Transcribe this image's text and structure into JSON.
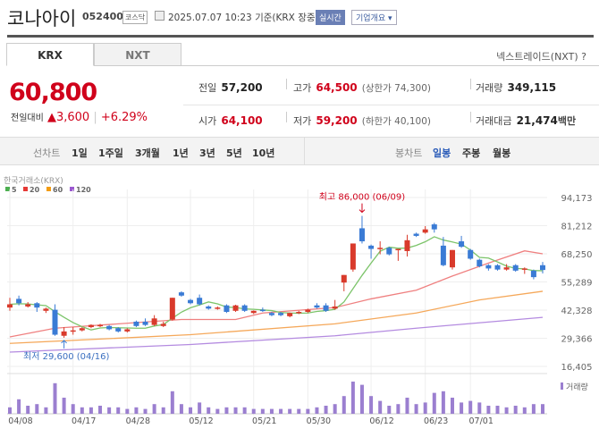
{
  "header": {
    "name": "코나아이",
    "code": "052400",
    "market": "코스닥",
    "datetime": "2025.07.07 10:23",
    "basis": "기준(KRX 장중)",
    "realtime_label": "실시간",
    "company_btn": "기업개요 ▾"
  },
  "tabs": [
    {
      "label": "KRX",
      "active": true
    },
    {
      "label": "NXT",
      "active": false
    }
  ],
  "nxt_link": "넥스트레이드(NXT) ?",
  "quote": {
    "price": "60,800",
    "change_label": "전일대비",
    "change": "▲3,600",
    "change_pct": "+6.29%",
    "prev_label": "전일",
    "prev": "57,200",
    "high_label": "고가",
    "high": "64,500",
    "upper_limit": "(상한가 74,300)",
    "volume_label": "거래량",
    "volume": "349,115",
    "open_label": "시가",
    "open": "64,100",
    "low_label": "저가",
    "low": "59,200",
    "lower_limit": "(하한가 40,100)",
    "amount_label": "거래대금",
    "amount": "21,474",
    "amount_unit": "백만"
  },
  "period_bar": {
    "line_label": "선차트",
    "line_periods": [
      "1일",
      "1주일",
      "3개월",
      "1년",
      "3년",
      "5년",
      "10년"
    ],
    "candle_label": "봉차트",
    "candle_periods": [
      "일봉",
      "주봉",
      "월봉"
    ],
    "selected": "일봉"
  },
  "chart_data": {
    "type": "candlestick",
    "source_label": "한국거래소(KRX)",
    "legend": [
      {
        "label": "5",
        "color": "#4caf50"
      },
      {
        "label": "20",
        "color": "#e53935"
      },
      {
        "label": "60",
        "color": "#f39c12"
      },
      {
        "label": "120",
        "color": "#9b59d0"
      }
    ],
    "y_ticks": [
      "94,173",
      "81,212",
      "68,250",
      "55,289",
      "42,328",
      "29,366",
      "16,405"
    ],
    "ylim": [
      16405,
      94173
    ],
    "x_ticks": [
      {
        "label": "04/08",
        "i": 0
      },
      {
        "label": "04/17",
        "i": 7
      },
      {
        "label": "04/28",
        "i": 13
      },
      {
        "label": "05/12",
        "i": 20
      },
      {
        "label": "05/21",
        "i": 27
      },
      {
        "label": "05/30",
        "i": 33
      },
      {
        "label": "06/12",
        "i": 40
      },
      {
        "label": "06/23",
        "i": 46
      },
      {
        "label": "07/01",
        "i": 51
      }
    ],
    "max_annotation": "최고 86,000 (06/09)",
    "max_index": 39,
    "min_annotation": "최저 29,600 (04/16)",
    "min_index": 6,
    "volume_label": "거래량",
    "ohlc": [
      [
        43500,
        48000,
        42000,
        45000
      ],
      [
        47500,
        49000,
        44500,
        45500
      ],
      [
        44000,
        46000,
        43500,
        45000
      ],
      [
        45500,
        46000,
        41500,
        43500
      ],
      [
        42000,
        43500,
        41000,
        43000
      ],
      [
        42500,
        45000,
        30500,
        31000
      ],
      [
        30500,
        34500,
        29600,
        32500
      ],
      [
        32500,
        34500,
        31000,
        33000
      ],
      [
        33000,
        34500,
        32500,
        34000
      ],
      [
        34500,
        35800,
        34000,
        35500
      ],
      [
        35000,
        36000,
        34500,
        35500
      ],
      [
        35000,
        35500,
        33000,
        33500
      ],
      [
        34000,
        34500,
        32000,
        32500
      ],
      [
        32500,
        34000,
        32000,
        33500
      ],
      [
        37000,
        37500,
        34500,
        35000
      ],
      [
        37000,
        38500,
        35000,
        35500
      ],
      [
        35500,
        40000,
        35000,
        38500
      ],
      [
        35000,
        37000,
        34500,
        36000
      ],
      [
        38000,
        48000,
        37500,
        48000
      ],
      [
        50500,
        51000,
        48500,
        49000
      ],
      [
        47000,
        47500,
        45000,
        45500
      ],
      [
        48000,
        49500,
        44500,
        45000
      ],
      [
        44000,
        44500,
        42500,
        43000
      ],
      [
        43000,
        44000,
        42500,
        43500
      ],
      [
        44500,
        45000,
        41000,
        41500
      ],
      [
        42000,
        44800,
        41500,
        44500
      ],
      [
        44500,
        45000,
        41500,
        42000
      ],
      [
        41000,
        42200,
        40500,
        42000
      ],
      [
        42500,
        43500,
        41500,
        42000
      ],
      [
        41000,
        41500,
        39500,
        40000
      ],
      [
        41000,
        41500,
        39500,
        40000
      ],
      [
        39500,
        41200,
        39000,
        41000
      ],
      [
        41000,
        42000,
        40500,
        41500
      ],
      [
        41500,
        43000,
        41000,
        42500
      ],
      [
        44500,
        45500,
        43000,
        43500
      ],
      [
        44500,
        45500,
        41500,
        42000
      ],
      [
        43000,
        47000,
        42500,
        44000
      ],
      [
        55000,
        58500,
        51000,
        58500
      ],
      [
        61000,
        73000,
        60000,
        73000
      ],
      [
        80000,
        85700,
        73000,
        74000
      ],
      [
        72000,
        72500,
        66000,
        70500
      ],
      [
        70500,
        74000,
        68000,
        71000
      ],
      [
        71000,
        71500,
        67500,
        68000
      ],
      [
        70000,
        70500,
        65000,
        70500
      ],
      [
        69500,
        77000,
        67000,
        74500
      ],
      [
        77500,
        78000,
        76000,
        76500
      ],
      [
        78000,
        81000,
        77500,
        79500
      ],
      [
        81800,
        82500,
        78000,
        79500
      ],
      [
        72000,
        76000,
        62500,
        63000
      ],
      [
        62000,
        70000,
        61000,
        70000
      ],
      [
        74000,
        76500,
        71000,
        71500
      ],
      [
        70000,
        70500,
        65500,
        66000
      ],
      [
        65500,
        66000,
        62000,
        62500
      ],
      [
        63000,
        63500,
        60500,
        61500
      ],
      [
        63000,
        63500,
        60500,
        61000
      ],
      [
        61000,
        63500,
        60500,
        62000
      ],
      [
        63000,
        63500,
        60000,
        60500
      ],
      [
        61000,
        62000,
        59000,
        61500
      ],
      [
        60500,
        61000,
        56500,
        57500
      ],
      [
        63000,
        64500,
        59200,
        60800
      ]
    ],
    "volumes": [
      0.2,
      0.45,
      0.25,
      0.3,
      0.2,
      0.95,
      0.5,
      0.3,
      0.2,
      0.2,
      0.25,
      0.2,
      0.2,
      0.15,
      0.2,
      0.15,
      0.3,
      0.2,
      0.7,
      0.3,
      0.2,
      0.35,
      0.2,
      0.15,
      0.2,
      0.2,
      0.2,
      0.15,
      0.15,
      0.15,
      0.15,
      0.15,
      0.15,
      0.15,
      0.2,
      0.25,
      0.3,
      0.55,
      1.0,
      0.9,
      0.55,
      0.4,
      0.25,
      0.3,
      0.5,
      0.3,
      0.35,
      0.65,
      0.7,
      0.5,
      0.35,
      0.4,
      0.35,
      0.25,
      0.25,
      0.2,
      0.25,
      0.2,
      0.3,
      0.3
    ],
    "ma20": [
      [
        0,
        30000
      ],
      [
        5,
        34000
      ],
      [
        19,
        38000
      ],
      [
        25,
        38000
      ],
      [
        28,
        41000
      ],
      [
        36,
        43500
      ],
      [
        40,
        47500
      ],
      [
        45,
        51500
      ],
      [
        49,
        58000
      ],
      [
        53,
        64000
      ],
      [
        57,
        69600
      ],
      [
        59,
        68250
      ]
    ],
    "ma60": [
      [
        0,
        27000
      ],
      [
        20,
        31000
      ],
      [
        36,
        36000
      ],
      [
        45,
        41000
      ],
      [
        52,
        47000
      ],
      [
        59,
        51000
      ]
    ],
    "ma120": [
      [
        0,
        23000
      ],
      [
        20,
        26500
      ],
      [
        36,
        30500
      ],
      [
        45,
        34000
      ],
      [
        59,
        39000
      ]
    ]
  }
}
